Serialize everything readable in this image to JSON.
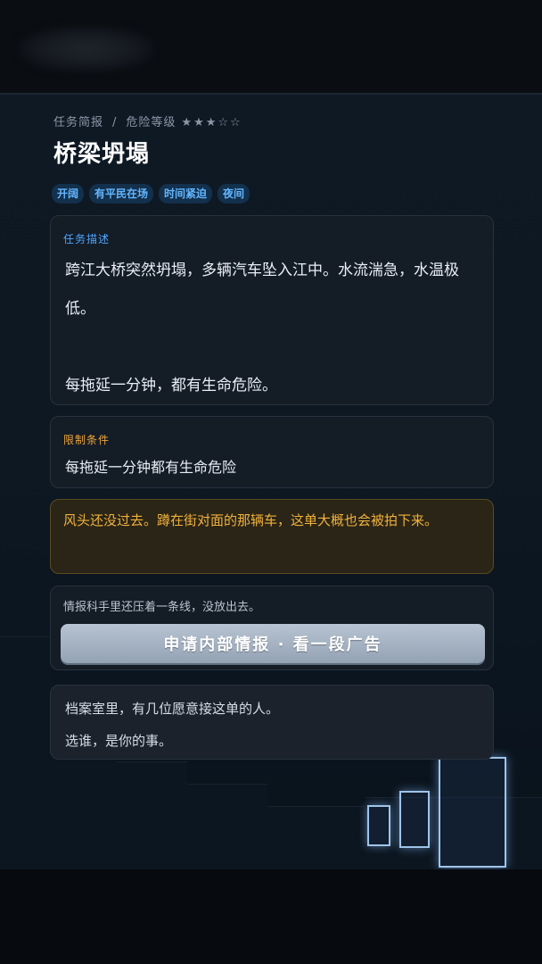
{
  "breadcrumb": {
    "section": "任务简报",
    "separator": "/",
    "danger_label": "危险等级",
    "danger_stars": "★★★☆☆"
  },
  "mission": {
    "title": "桥梁坍塌",
    "tags": [
      "开阔",
      "有平民在场",
      "时间紧迫",
      "夜间"
    ],
    "danger_level": 3,
    "danger_max": 5
  },
  "description": {
    "label": "任务描述",
    "line1": "跨江大桥突然坍塌，多辆汽车坠入江中。水流湍急，水温极低。",
    "line2": "每拖延一分钟，都有生命危险。"
  },
  "constraints": {
    "label": "限制条件",
    "text": "每拖延一分钟都有生命危险"
  },
  "warning": {
    "text": "风头还没过去。蹲在街对面的那辆车，这单大概也会被拍下来。"
  },
  "intel": {
    "text": "情报科手里还压着一条线，没放出去。",
    "button_label": "申请内部情报 · 看一段广告"
  },
  "archive": {
    "line1": "档案室里，有几位愿意接这单的人。",
    "line2": "选谁，是你的事。"
  },
  "colors": {
    "accent_blue": "#4ea6ff",
    "tag_text": "#63b6ff",
    "constraint_label": "#f0a63a",
    "warning_text": "#f2b13e",
    "card_bg": "#141c26",
    "page_bg": "#0d1822"
  }
}
